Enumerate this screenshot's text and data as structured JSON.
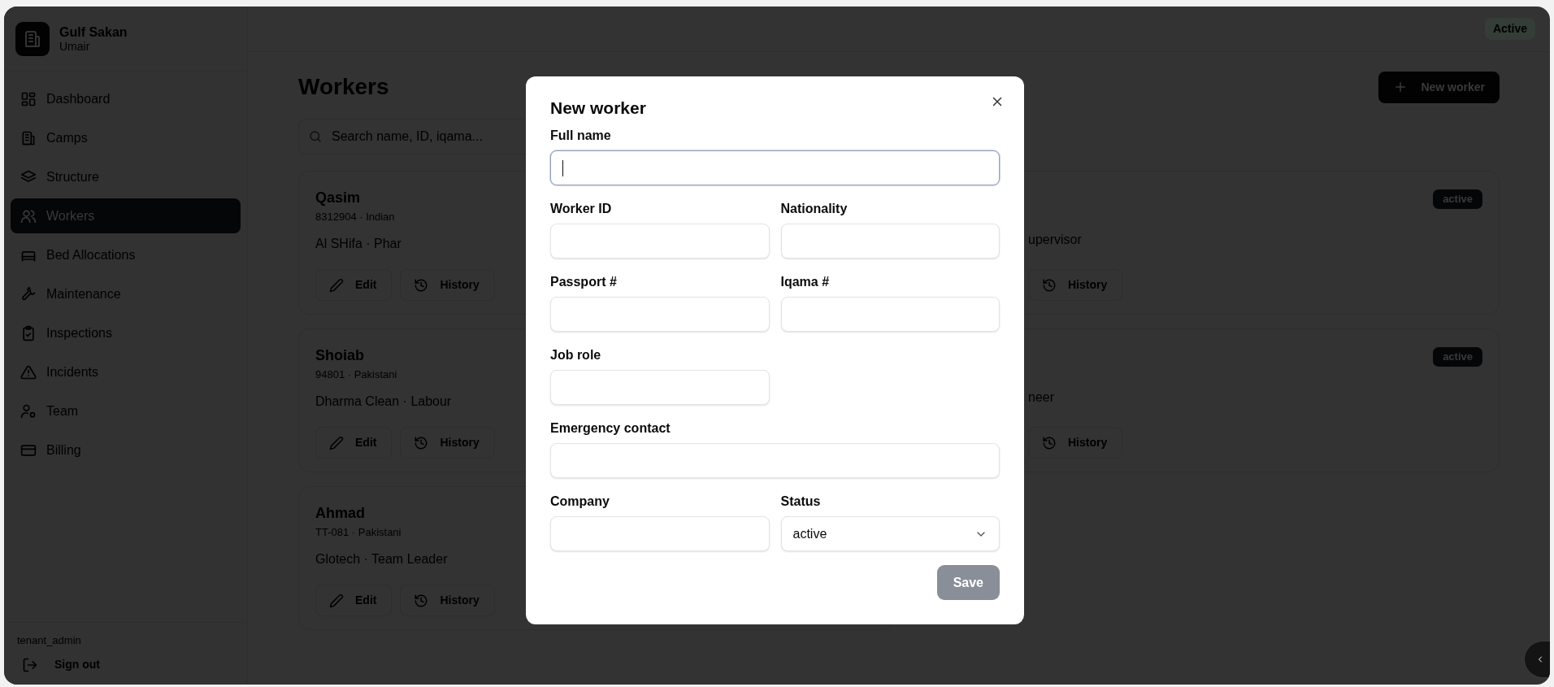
{
  "brand": {
    "name": "Gulf Sakan",
    "user": "Umair"
  },
  "nav": [
    {
      "label": "Dashboard",
      "selected": false
    },
    {
      "label": "Camps",
      "selected": false
    },
    {
      "label": "Structure",
      "selected": false
    },
    {
      "label": "Workers",
      "selected": true
    },
    {
      "label": "Bed Allocations",
      "selected": false
    },
    {
      "label": "Maintenance",
      "selected": false
    },
    {
      "label": "Inspections",
      "selected": false
    },
    {
      "label": "Incidents",
      "selected": false
    },
    {
      "label": "Team",
      "selected": false
    },
    {
      "label": "Billing",
      "selected": false
    }
  ],
  "role": "tenant_admin",
  "sign_out": "Sign out",
  "header_badge": "Active",
  "page": {
    "title": "Workers",
    "new_button": "New worker",
    "search_placeholder": "Search name, ID, iqama..."
  },
  "cards": [
    {
      "name": "Qasim",
      "meta": "8312904 · Indian",
      "detail": "Al SHifa · Phar",
      "buttons": [
        "Edit",
        "History"
      ]
    },
    {
      "status": "active",
      "detail": "upervisor",
      "buttons": [
        "History"
      ]
    },
    {
      "name": "Shoiab",
      "meta": "94801 · Pakistani",
      "detail": "Dharma Clean · Labour",
      "buttons": [
        "Edit",
        "History"
      ]
    },
    {
      "status": "active",
      "detail": "neer",
      "buttons": [
        "History"
      ]
    },
    {
      "name": "Ahmad",
      "meta": "TT-081 · Pakistani",
      "detail": "Glotech · Team Leader",
      "buttons": [
        "Edit",
        "History"
      ]
    }
  ],
  "modal": {
    "title": "New worker",
    "fields": [
      {
        "label": "Full name",
        "kind": "long-text",
        "focused": true
      },
      {
        "label": "Worker ID",
        "kind": "text",
        "focused": false
      },
      {
        "label": "Nationality",
        "kind": "text",
        "focused": false
      },
      {
        "label": "Passport #",
        "kind": "text",
        "focused": false
      },
      {
        "label": "Iqama #",
        "kind": "text",
        "focused": false
      },
      {
        "label": "Job role",
        "kind": "text",
        "focused": false
      },
      {
        "label": "Emergency contact",
        "kind": "long-text",
        "focused": false
      },
      {
        "label": "Company",
        "kind": "text",
        "focused": false
      },
      {
        "label": "Status",
        "kind": "select",
        "value": "active",
        "focused": false
      }
    ],
    "save": {
      "label": "Save",
      "disabled": true
    }
  }
}
